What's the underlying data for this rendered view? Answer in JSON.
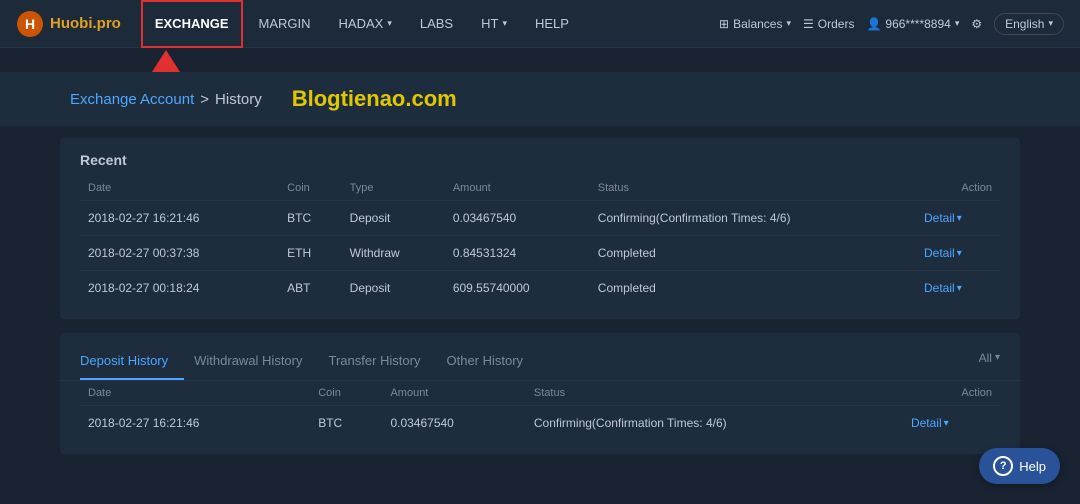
{
  "navbar": {
    "logo_text": "Huobi",
    "logo_suffix": ".pro",
    "nav_items": [
      {
        "id": "exchange",
        "label": "EXCHANGE",
        "active": true
      },
      {
        "id": "margin",
        "label": "MARGIN",
        "active": false
      },
      {
        "id": "hadax",
        "label": "HADAX",
        "active": false,
        "has_arrow": true
      },
      {
        "id": "labs",
        "label": "LABS",
        "active": false
      },
      {
        "id": "ht",
        "label": "HT",
        "active": false,
        "has_arrow": true
      },
      {
        "id": "help",
        "label": "HELP",
        "active": false
      }
    ],
    "balances_label": "Balances",
    "orders_label": "Orders",
    "user_label": "966****8894",
    "settings_icon": "⚙",
    "language": "English"
  },
  "breadcrumb": {
    "link_text": "Exchange Account",
    "separator": ">",
    "current": "History"
  },
  "watermark": "Blogtienao.com",
  "recent": {
    "title": "Recent",
    "columns": [
      "Date",
      "Coin",
      "Type",
      "Amount",
      "Status",
      "Action"
    ],
    "rows": [
      {
        "date": "2018-02-27 16:21:46",
        "coin": "BTC",
        "type": "Deposit",
        "amount": "0.03467540",
        "status": "Confirming(Confirmation Times: 4/6)",
        "action": "Detail"
      },
      {
        "date": "2018-02-27 00:37:38",
        "coin": "ETH",
        "type": "Withdraw",
        "amount": "0.84531324",
        "status": "Completed",
        "action": "Detail"
      },
      {
        "date": "2018-02-27 00:18:24",
        "coin": "ABT",
        "type": "Deposit",
        "amount": "609.55740000",
        "status": "Completed",
        "action": "Detail"
      }
    ]
  },
  "history": {
    "tabs": [
      {
        "id": "deposit",
        "label": "Deposit History",
        "active": true
      },
      {
        "id": "withdrawal",
        "label": "Withdrawal History",
        "active": false
      },
      {
        "id": "transfer",
        "label": "Transfer History",
        "active": false
      },
      {
        "id": "other",
        "label": "Other History",
        "active": false
      }
    ],
    "filter_label": "All",
    "columns": [
      "Date",
      "Coin",
      "Amount",
      "Status",
      "Action"
    ],
    "rows": [
      {
        "date": "2018-02-27 16:21:46",
        "coin": "BTC",
        "amount": "0.03467540",
        "status": "Confirming(Confirmation Times: 4/6)",
        "action": "Detail"
      }
    ]
  },
  "help_button": "Help"
}
